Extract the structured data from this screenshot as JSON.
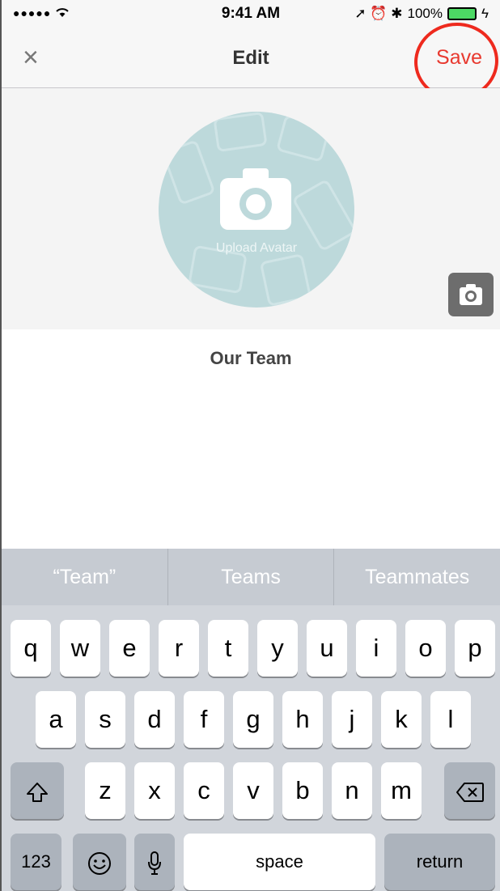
{
  "status_bar": {
    "signal": "●●●●● ",
    "wifi": "wifi-icon",
    "time": "9:41 AM",
    "icons": "➚ ⏰ ✱",
    "battery_text": "100%"
  },
  "nav": {
    "close_glyph": "×",
    "title": "Edit",
    "save_label": "Save"
  },
  "avatar": {
    "upload_label": "Upload Avatar"
  },
  "team": {
    "name": "Our Team"
  },
  "keyboard": {
    "predictions": [
      "“Team”",
      "Teams",
      "Teammates"
    ],
    "row1": [
      "q",
      "w",
      "e",
      "r",
      "t",
      "y",
      "u",
      "i",
      "o",
      "p"
    ],
    "row2": [
      "a",
      "s",
      "d",
      "f",
      "g",
      "h",
      "j",
      "k",
      "l"
    ],
    "row3": [
      "z",
      "x",
      "c",
      "v",
      "b",
      "n",
      "m"
    ],
    "numbers_label": "123",
    "space_label": "space",
    "return_label": "return"
  },
  "colors": {
    "accent": "#e8392f",
    "annotation_ring": "#ee2a1e"
  }
}
